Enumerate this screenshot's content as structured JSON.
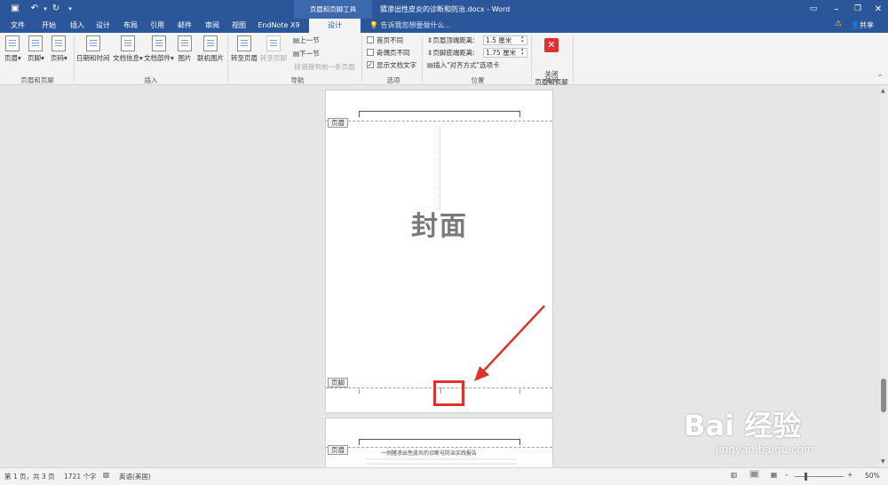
{
  "window": {
    "doc_title": "猜渗出性皮炎的诊断和防治.docx - Word",
    "context_group": "页眉和页脚工具",
    "tell_me": "告诉我您想要做什么...",
    "share": "共享",
    "qat_icons": [
      "save-icon",
      "undo-icon",
      "redo-icon",
      "customize-icon"
    ]
  },
  "tabs": [
    "文件",
    "开始",
    "插入",
    "设计",
    "布局",
    "引用",
    "邮件",
    "审阅",
    "视图",
    "EndNote X9",
    "设计"
  ],
  "active_tab_index": 10,
  "ribbon": {
    "group1": {
      "label": "页眉和页脚",
      "buttons": [
        "页眉",
        "页脚",
        "页码"
      ]
    },
    "group2": {
      "label": "插入",
      "buttons": [
        "日期和时间",
        "文档信息",
        "文档部件",
        "图片",
        "联机图片"
      ]
    },
    "group3": {
      "label": "导航",
      "buttons": [
        "转至页眉",
        "转至页脚"
      ],
      "small": [
        "上一节",
        "下一节",
        "链接到前一条页眉"
      ]
    },
    "group4": {
      "label": "选项",
      "checks": [
        {
          "label": "首页不同",
          "checked": false
        },
        {
          "label": "奇偶页不同",
          "checked": false
        },
        {
          "label": "显示文档文字",
          "checked": true
        }
      ]
    },
    "group5": {
      "label": "位置",
      "header_dist_label": "页眉顶端距离:",
      "header_dist": "1.5 厘米",
      "footer_dist_label": "页脚底端距离:",
      "footer_dist": "1.75 厘米",
      "align_tab": "插入\"对齐方式\"选项卡"
    },
    "group6": {
      "label": "关闭",
      "close_label": "关闭\n页眉和页脚"
    }
  },
  "page1": {
    "header_tag": "页眉",
    "title": "封面",
    "footer_tag": "页脚"
  },
  "page2": {
    "header_tag": "页眉",
    "heading": "一例猪渗出性皮炎的诊断与防治实践报告"
  },
  "status": {
    "page": "第 1 页，共 3 页",
    "words": "1721 个字",
    "lang": "英语(美国)",
    "zoom": "50%"
  },
  "watermark": {
    "logo": "Bai 经验",
    "url": "jingyan.baidu.com"
  },
  "colors": {
    "accent": "#2b579a",
    "annotation": "#e03131"
  }
}
